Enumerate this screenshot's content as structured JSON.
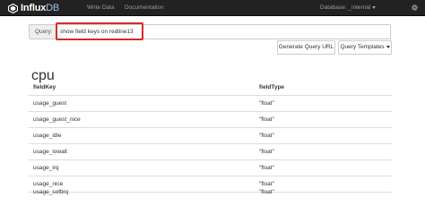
{
  "navbar": {
    "brand_main": "Influx",
    "brand_accent": "DB",
    "links": [
      "Write Data",
      "Documentation"
    ],
    "database_label": "Database: _internal",
    "settings_icon": "gear-icon",
    "brand_icon": "influxdb-logo-icon"
  },
  "query": {
    "label": "Query:",
    "value": "show field keys on redline13",
    "highlight_color": "#d9292b"
  },
  "buttons": {
    "generate": "Generate Query URL",
    "templates": "Query Templates"
  },
  "results": {
    "series_name": "cpu",
    "columns": [
      "fieldKey",
      "fieldType"
    ],
    "rows": [
      [
        "usage_guest",
        "\"float\""
      ],
      [
        "usage_guest_nice",
        "\"float\""
      ],
      [
        "usage_idle",
        "\"float\""
      ],
      [
        "usage_iowait",
        "\"float\""
      ],
      [
        "usage_irq",
        "\"float\""
      ],
      [
        "usage_nice",
        "\"float\""
      ],
      [
        "usage_softirq",
        "\"float\""
      ]
    ]
  },
  "colors": {
    "navbar_bg": "#222222",
    "nav_text": "#9d9d9d",
    "accent": "#9fc3e6"
  }
}
